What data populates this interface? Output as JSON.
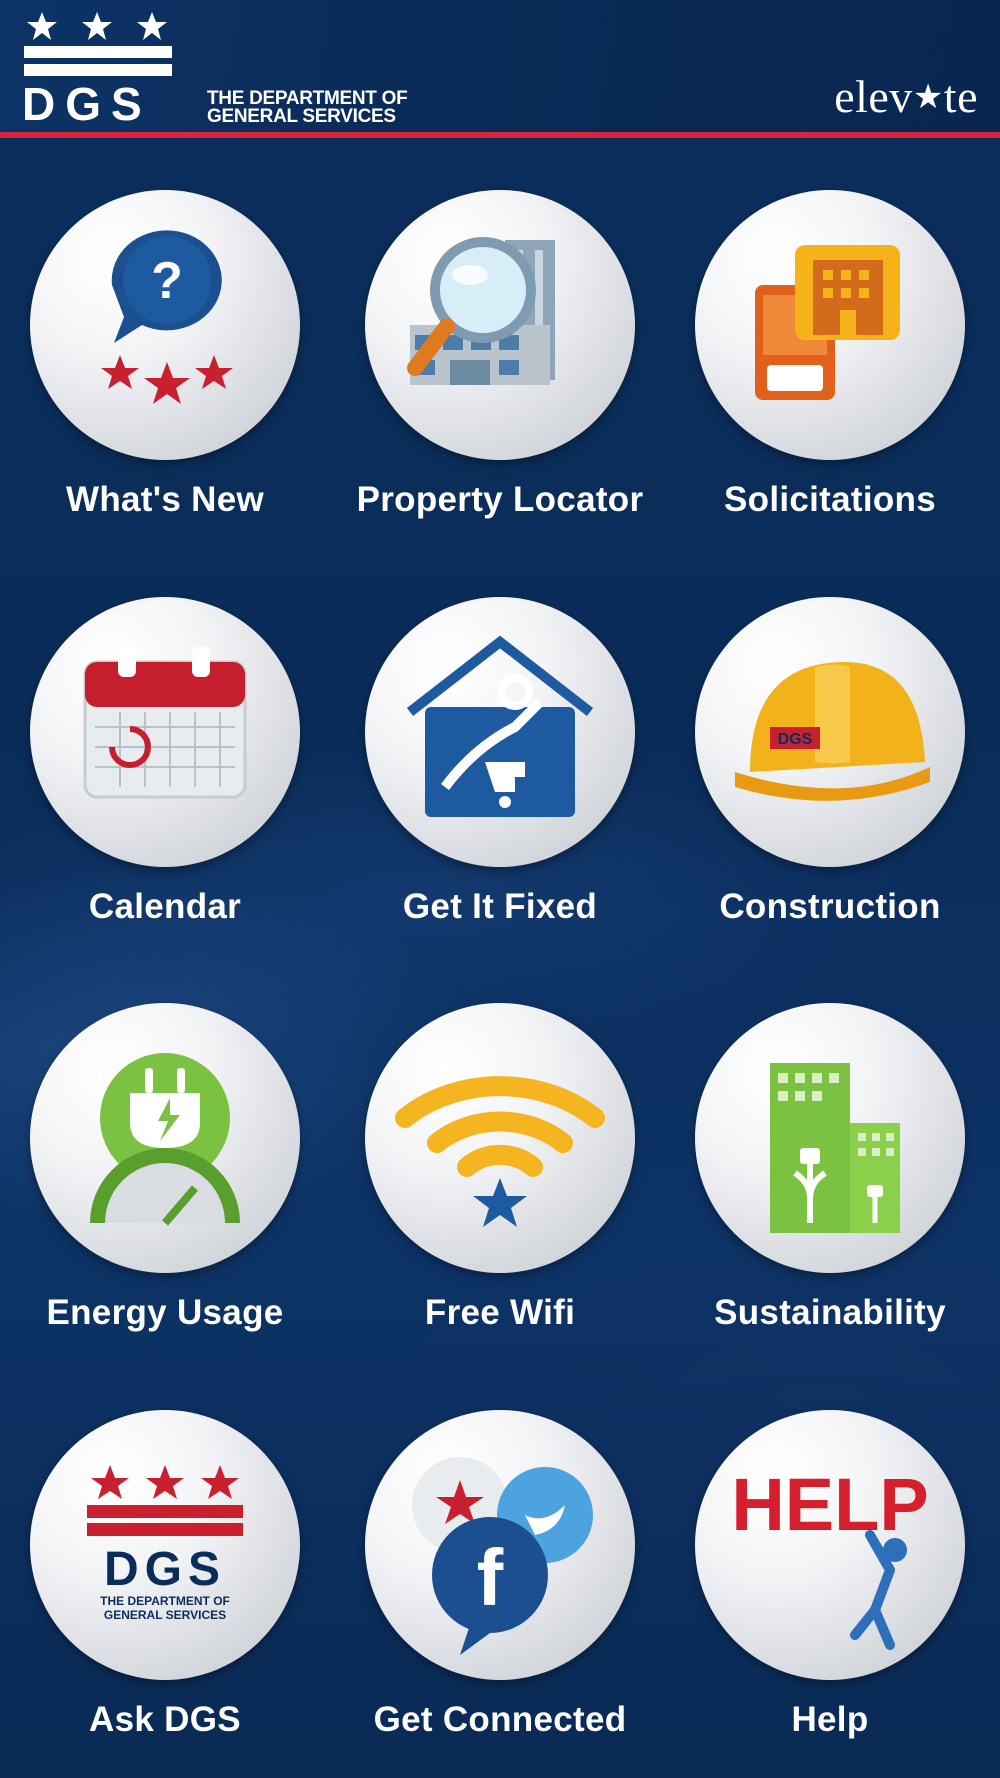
{
  "header": {
    "logo_text": "DGS",
    "org_name_line1": "THE DEPARTMENT OF",
    "org_name_line2": "GENERAL SERVICES",
    "brand_left": "elev",
    "brand_star": "★",
    "brand_right": "te"
  },
  "tiles": [
    {
      "label": "What's New",
      "icon": "question-chat-icon"
    },
    {
      "label": "Property Locator",
      "icon": "magnifier-building-icon"
    },
    {
      "label": "Solicitations",
      "icon": "phone-building-icon"
    },
    {
      "label": "Calendar",
      "icon": "calendar-icon"
    },
    {
      "label": "Get It Fixed",
      "icon": "house-repair-icon"
    },
    {
      "label": "Construction",
      "icon": "hard-hat-icon"
    },
    {
      "label": "Energy Usage",
      "icon": "plug-gauge-icon"
    },
    {
      "label": "Free Wifi",
      "icon": "wifi-star-icon"
    },
    {
      "label": "Sustainability",
      "icon": "green-buildings-icon"
    },
    {
      "label": "Ask DGS",
      "icon": "dgs-logo-icon"
    },
    {
      "label": "Get Connected",
      "icon": "social-bubbles-icon"
    },
    {
      "label": "Help",
      "icon": "help-climber-icon"
    }
  ],
  "tile_icon_texts": {
    "ask_dgs_logo": "DGS",
    "ask_dgs_sub1": "THE DEPARTMENT OF",
    "ask_dgs_sub2": "GENERAL SERVICES",
    "help_word": "HELP",
    "hat_text": "DGS"
  },
  "colors": {
    "background": "#0b2d5c",
    "accent_red": "#d7263b",
    "label": "#ffffff"
  }
}
